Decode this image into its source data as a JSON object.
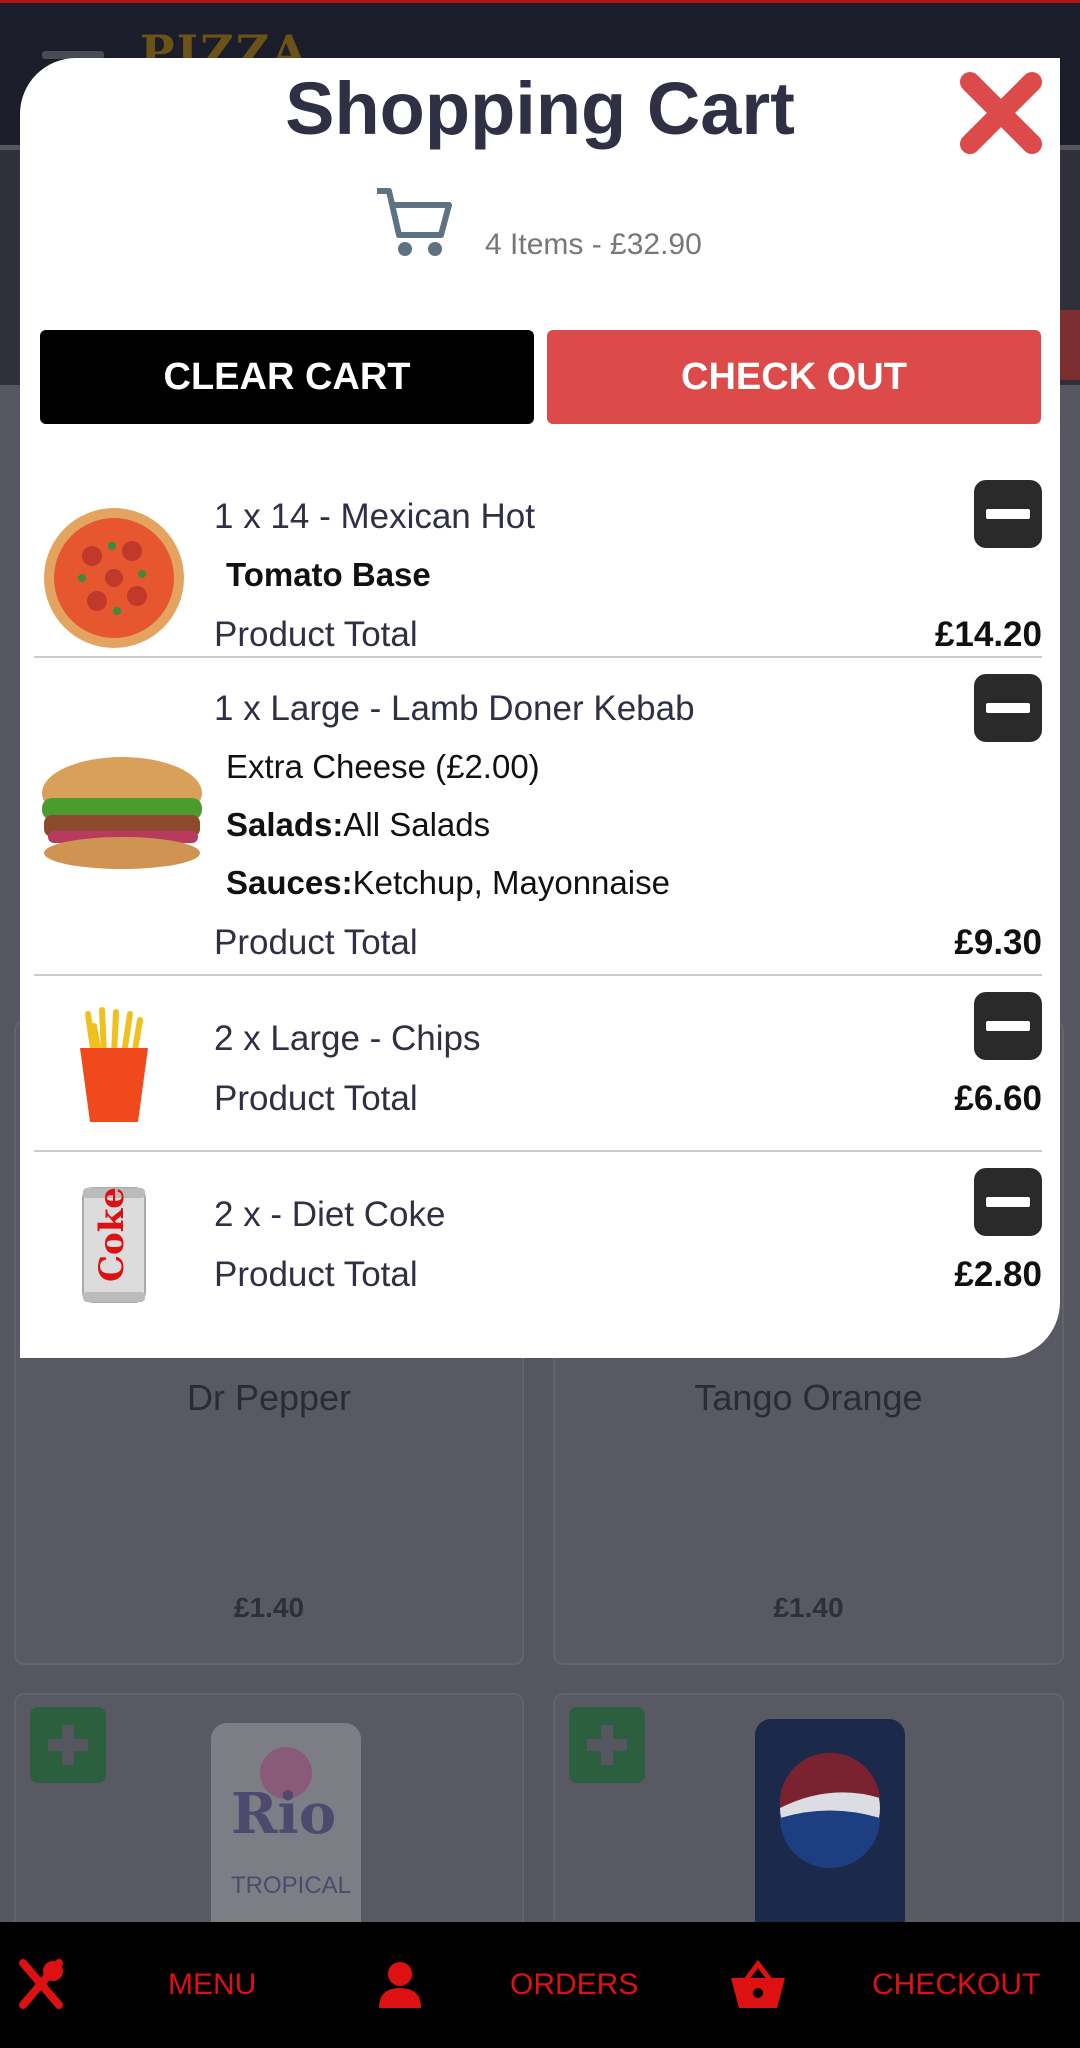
{
  "background": {
    "logo_text": "PIZZA",
    "cards": [
      {
        "name": "Dr Pepper",
        "price": "£1.40"
      },
      {
        "name": "Tango Orange",
        "price": "£1.40"
      }
    ]
  },
  "cart": {
    "title": "Shopping Cart",
    "summary": "4 Items - £32.90",
    "clear_label": "CLEAR CART",
    "checkout_label": "CHECK OUT",
    "items": [
      {
        "title": "1 x 14 - Mexican Hot",
        "options": [
          {
            "label": "",
            "value": "Tomato Base",
            "bold_value": true
          }
        ],
        "total_label": "Product Total",
        "price": "£14.20",
        "image": "pizza"
      },
      {
        "title": "1 x Large - Lamb Doner Kebab",
        "options": [
          {
            "label": "",
            "value": "Extra Cheese (£2.00)"
          },
          {
            "label": "Salads:",
            "value": "All Salads"
          },
          {
            "label": "Sauces:",
            "value": "Ketchup, Mayonnaise"
          }
        ],
        "total_label": "Product Total",
        "price": "£9.30",
        "image": "kebab"
      },
      {
        "title": "2 x Large - Chips",
        "options": [],
        "total_label": "Product Total",
        "price": "£6.60",
        "image": "chips"
      },
      {
        "title": "2 x - Diet Coke",
        "options": [],
        "total_label": "Product Total",
        "price": "£2.80",
        "image": "diet-coke"
      }
    ]
  },
  "bottom_nav": {
    "menu": "MENU",
    "orders": "ORDERS",
    "checkout": "CHECKOUT"
  },
  "colors": {
    "accent_red": "#dd4a4a",
    "nav_red": "#dd1111",
    "title_dark": "#2f3044"
  }
}
